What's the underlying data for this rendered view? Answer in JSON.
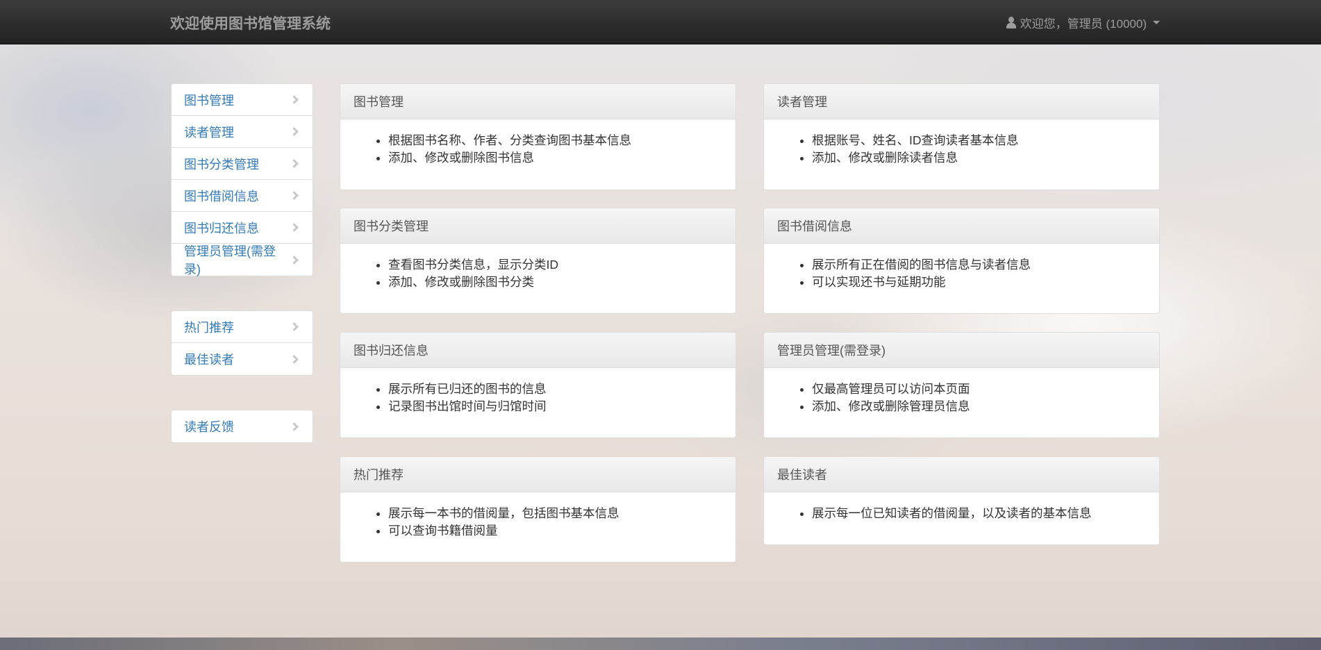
{
  "navbar": {
    "brand": "欢迎使用图书馆管理系统",
    "user_label": "欢迎您，管理员 (10000)"
  },
  "sidebar": {
    "group1": [
      {
        "label": "图书管理"
      },
      {
        "label": "读者管理"
      },
      {
        "label": "图书分类管理"
      },
      {
        "label": "图书借阅信息"
      },
      {
        "label": "图书归还信息"
      },
      {
        "label": "管理员管理(需登录)"
      }
    ],
    "group2": [
      {
        "label": "热门推荐"
      },
      {
        "label": "最佳读者"
      }
    ],
    "group3": [
      {
        "label": "读者反馈"
      }
    ]
  },
  "panels": [
    {
      "title": "图书管理",
      "items": [
        "根据图书名称、作者、分类查询图书基本信息",
        "添加、修改或删除图书信息"
      ]
    },
    {
      "title": "读者管理",
      "items": [
        "根据账号、姓名、ID查询读者基本信息",
        "添加、修改或删除读者信息"
      ]
    },
    {
      "title": "图书分类管理",
      "items": [
        "查看图书分类信息，显示分类ID",
        "添加、修改或删除图书分类"
      ]
    },
    {
      "title": "图书借阅信息",
      "items": [
        "展示所有正在借阅的图书信息与读者信息",
        "可以实现还书与延期功能"
      ]
    },
    {
      "title": "图书归还信息",
      "items": [
        "展示所有已归还的图书的信息",
        "记录图书出馆时间与归馆时间"
      ]
    },
    {
      "title": "管理员管理(需登录)",
      "items": [
        "仅最高管理员可以访问本页面",
        "添加、修改或删除管理员信息"
      ]
    },
    {
      "title": "热门推荐",
      "items": [
        "展示每一本书的借阅量，包括图书基本信息",
        "可以查询书籍借阅量"
      ]
    },
    {
      "title": "最佳读者",
      "items": [
        "展示每一位已知读者的借阅量，以及读者的基本信息"
      ]
    }
  ]
}
